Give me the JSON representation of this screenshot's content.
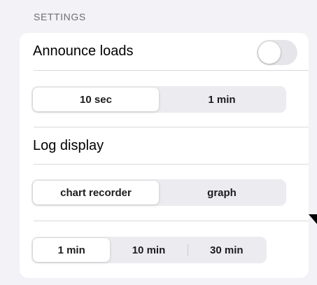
{
  "settings": {
    "section_title": "SETTINGS",
    "announce_loads": {
      "label": "Announce loads",
      "enabled": false
    },
    "announce_interval": {
      "options": [
        "10 sec",
        "1 min"
      ],
      "selected": "10 sec"
    },
    "log_display": {
      "label": "Log display",
      "options": [
        "chart recorder",
        "graph"
      ],
      "selected": "chart recorder"
    },
    "log_window": {
      "options": [
        "1 min",
        "10 min",
        "30 min"
      ],
      "selected": "1 min"
    }
  },
  "colors": {
    "background": "#f2f2f7",
    "card": "#ffffff",
    "segmented_track": "#ececf0",
    "toggle_off": "#e6e6ea",
    "section_header": "#6d6d72"
  }
}
